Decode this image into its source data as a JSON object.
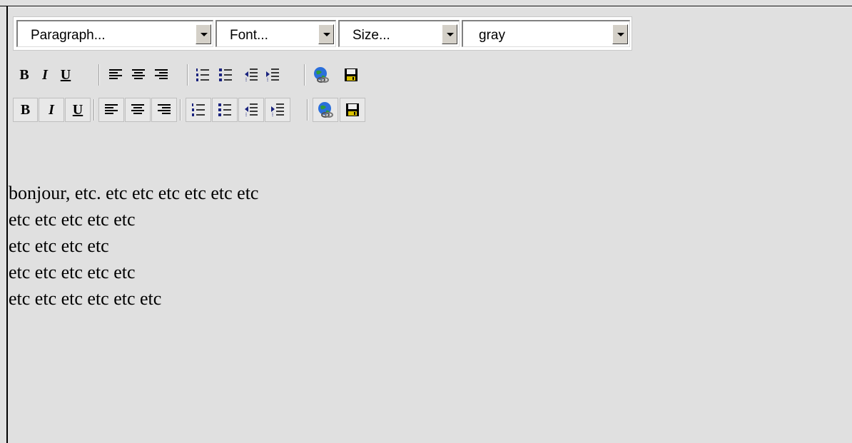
{
  "selects": {
    "paragraph": "Paragraph...",
    "font": "Font...",
    "size": "Size...",
    "color": "gray"
  },
  "toolbar": {
    "bold": "B",
    "italic": "I",
    "underline": "U",
    "icons": [
      "bold-icon",
      "italic-icon",
      "underline-icon",
      "align-left-icon",
      "align-center-icon",
      "align-right-icon",
      "ordered-list-icon",
      "unordered-list-icon",
      "outdent-icon",
      "indent-icon",
      "insert-link-icon",
      "save-icon"
    ]
  },
  "editor": {
    "lines": [
      "bonjour, etc. etc etc etc etc etc etc",
      "etc etc etc etc etc",
      "etc etc etc etc",
      "etc etc etc etc etc",
      "etc etc etc etc etc etc"
    ]
  },
  "colors": {
    "background": "#e0e0e0",
    "icon_blue": "#1a237e"
  }
}
